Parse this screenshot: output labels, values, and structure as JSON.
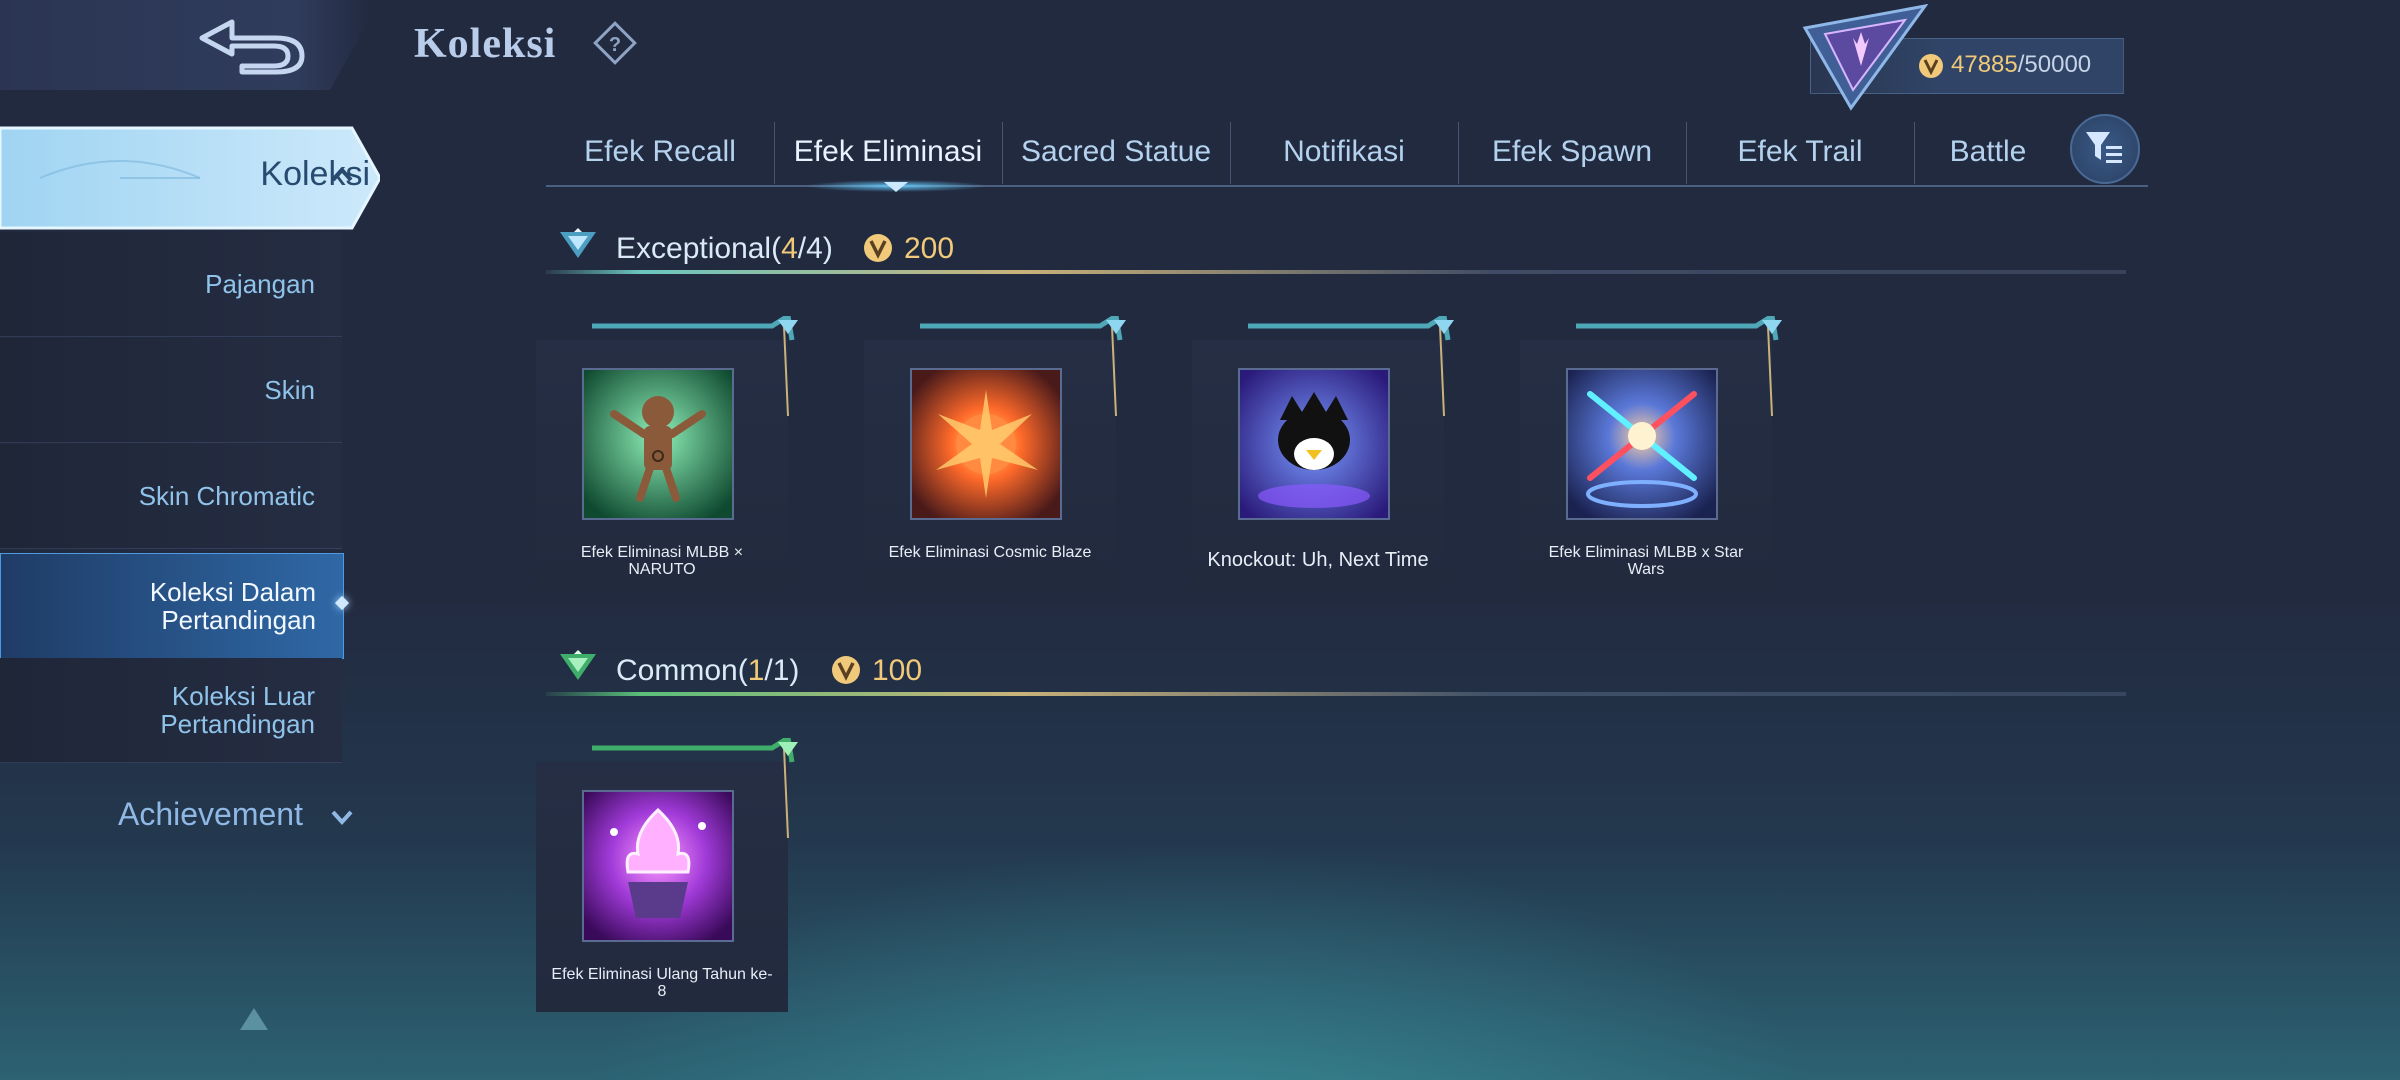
{
  "header": {
    "title": "Koleksi",
    "currency_value": "47885",
    "currency_max": "/50000"
  },
  "sidebar": {
    "main_label": "Koleksi",
    "items": [
      {
        "label": "Pajangan"
      },
      {
        "label": "Skin"
      },
      {
        "label": "Skin Chromatic"
      },
      {
        "label": "Koleksi Dalam Pertandingan"
      },
      {
        "label": "Koleksi Luar Pertandingan"
      }
    ],
    "achievement_label": "Achievement"
  },
  "tabs": [
    {
      "label": "Efek Recall"
    },
    {
      "label": "Efek Eliminasi"
    },
    {
      "label": "Sacred Statue"
    },
    {
      "label": "Notifikasi"
    },
    {
      "label": "Efek Spawn"
    },
    {
      "label": "Efek Trail"
    },
    {
      "label": "Battle"
    }
  ],
  "active_tab": "Efek Eliminasi",
  "sections": [
    {
      "name": "Exceptional",
      "count": "(4/4)",
      "count_open": "(",
      "count_have": "4",
      "count_rest": "/4)",
      "cost": "200",
      "items": [
        {
          "label": "Efek Eliminasi MLBB × NARUTO"
        },
        {
          "label": "Efek Eliminasi Cosmic Blaze"
        },
        {
          "label": "Knockout: Uh, Next Time"
        },
        {
          "label": "Efek Eliminasi MLBB x Star Wars"
        }
      ]
    },
    {
      "name": "Common",
      "count_open": "(",
      "count_have": "1",
      "count_rest": "/1)",
      "cost": "100",
      "items": [
        {
          "label": "Efek Eliminasi Ulang Tahun ke-8"
        }
      ]
    }
  ],
  "colors": {
    "accent_gold": "#f0c97a",
    "sidebar_active": "#2f68a6",
    "background": "#222a40"
  }
}
